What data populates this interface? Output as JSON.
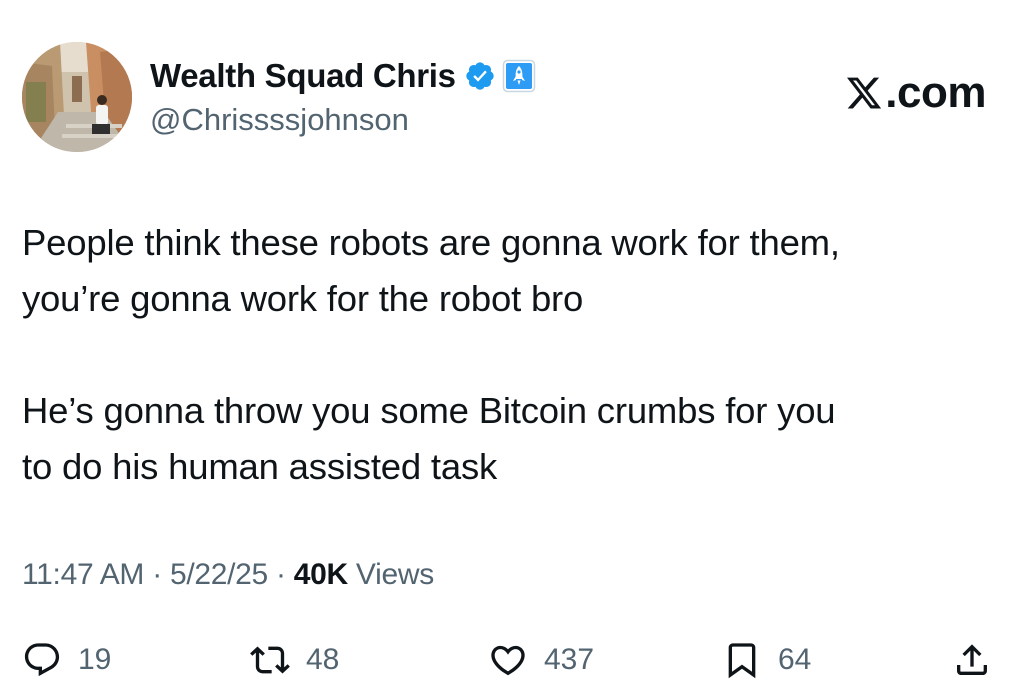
{
  "author": {
    "display_name": "Wealth Squad Chris",
    "handle": "@Chrissssjohnson",
    "verified_badge_color": "#1d9bf0",
    "affiliate_badge_color": "#2e9cf5"
  },
  "brand": {
    "label": ".com",
    "icon": "x-logo-icon"
  },
  "tweet": {
    "paragraphs": [
      [
        "People think these robots are gonna work for them,",
        "you’re gonna work for the robot bro"
      ],
      [
        "He’s gonna throw you some Bitcoin crumbs for you",
        "to do his human assisted task"
      ]
    ]
  },
  "meta": {
    "time": "11:47 AM",
    "separator": "·",
    "date": "5/22/25",
    "views_count": "40K",
    "views_label": "Views"
  },
  "actions": {
    "replies": "19",
    "reposts": "48",
    "likes": "437",
    "bookmarks": "64"
  },
  "colors": {
    "text_primary": "#0f1419",
    "text_secondary": "#536471"
  }
}
